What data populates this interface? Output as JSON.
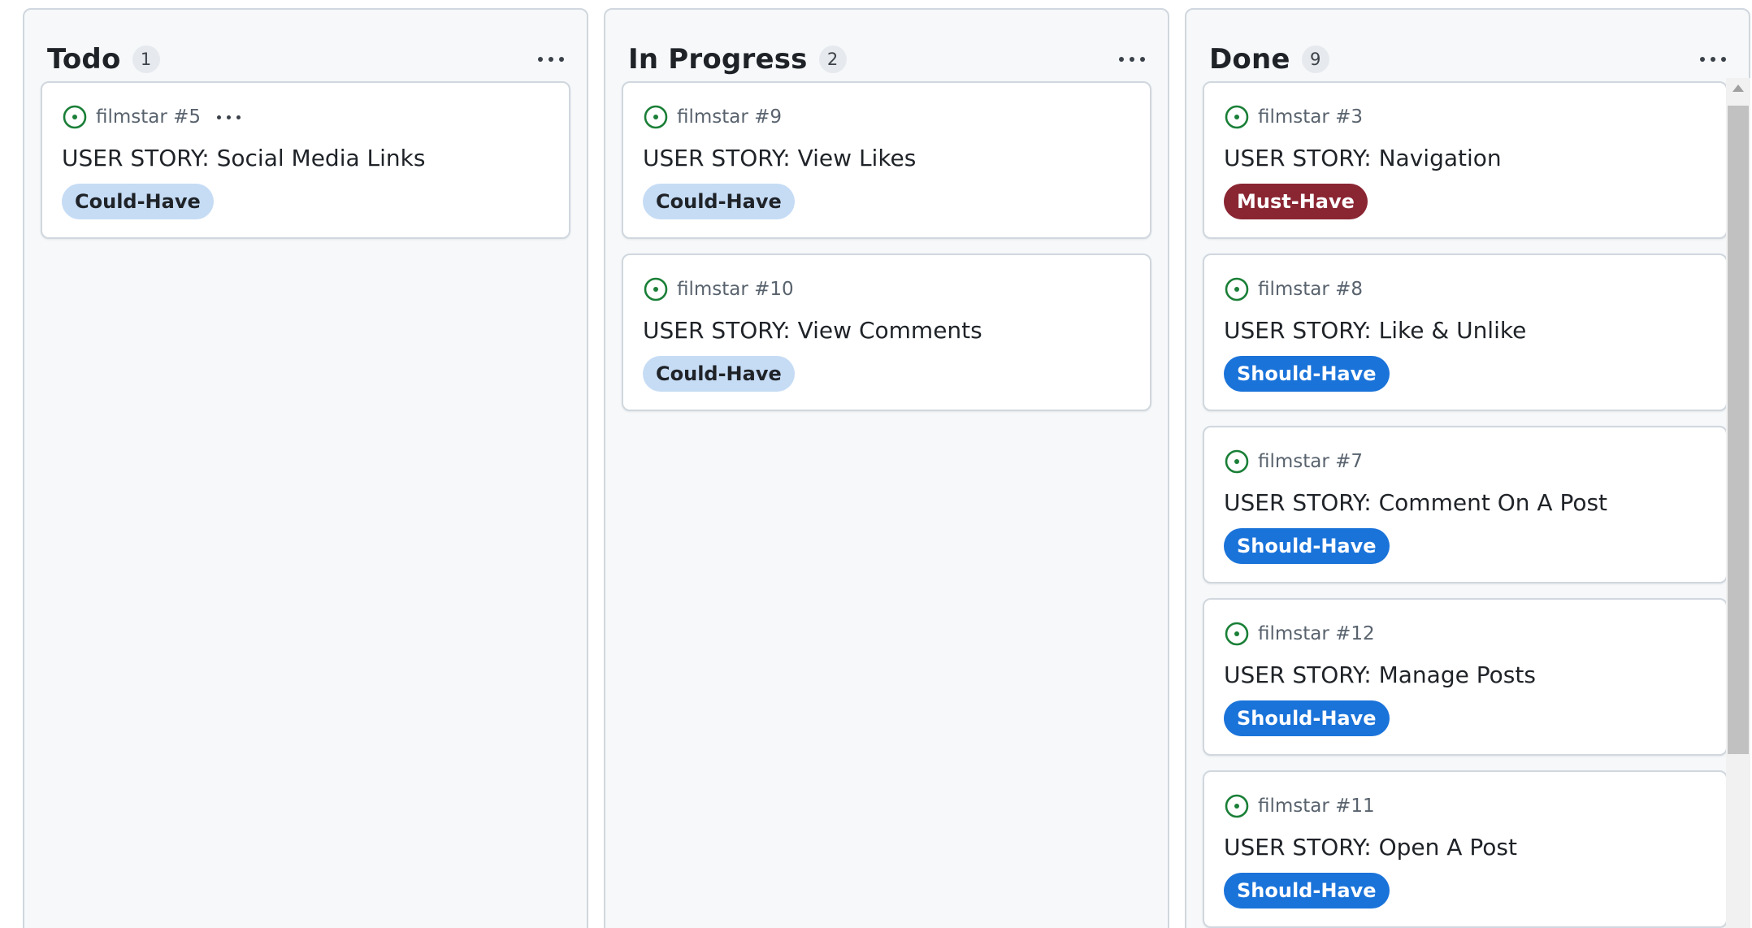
{
  "colors": {
    "status_open": "#1a7f37",
    "label_could_have_bg": "#c6dcf5",
    "label_must_have_bg": "#8a2532",
    "label_should_have_bg": "#1a73d9"
  },
  "columns": [
    {
      "title": "Todo",
      "count": "1",
      "menu_icon": "kebab-horizontal-icon",
      "cards": [
        {
          "status_icon": "issue-opened-icon",
          "repo": "filmstar #5",
          "title": "USER STORY: Social Media Links",
          "label": "Could-Have",
          "label_type": "could"
        }
      ]
    },
    {
      "title": "In Progress",
      "count": "2",
      "menu_icon": "kebab-horizontal-icon",
      "cards": [
        {
          "status_icon": "issue-opened-icon",
          "repo": "filmstar #9",
          "title": "USER STORY: View Likes",
          "label": "Could-Have",
          "label_type": "could"
        },
        {
          "status_icon": "issue-opened-icon",
          "repo": "filmstar #10",
          "title": "USER STORY: View Comments",
          "label": "Could-Have",
          "label_type": "could"
        }
      ]
    },
    {
      "title": "Done",
      "count": "9",
      "menu_icon": "kebab-horizontal-icon",
      "cards": [
        {
          "status_icon": "issue-opened-icon",
          "repo": "filmstar #3",
          "title": "USER STORY: Navigation",
          "label": "Must-Have",
          "label_type": "must"
        },
        {
          "status_icon": "issue-opened-icon",
          "repo": "filmstar #8",
          "title": "USER STORY: Like & Unlike",
          "label": "Should-Have",
          "label_type": "should"
        },
        {
          "status_icon": "issue-opened-icon",
          "repo": "filmstar #7",
          "title": "USER STORY: Comment On A Post",
          "label": "Should-Have",
          "label_type": "should"
        },
        {
          "status_icon": "issue-opened-icon",
          "repo": "filmstar #12",
          "title": "USER STORY: Manage Posts",
          "label": "Should-Have",
          "label_type": "should"
        },
        {
          "status_icon": "issue-opened-icon",
          "repo": "filmstar #11",
          "title": "USER STORY: Open A Post",
          "label": "Should-Have",
          "label_type": "should"
        }
      ]
    }
  ]
}
